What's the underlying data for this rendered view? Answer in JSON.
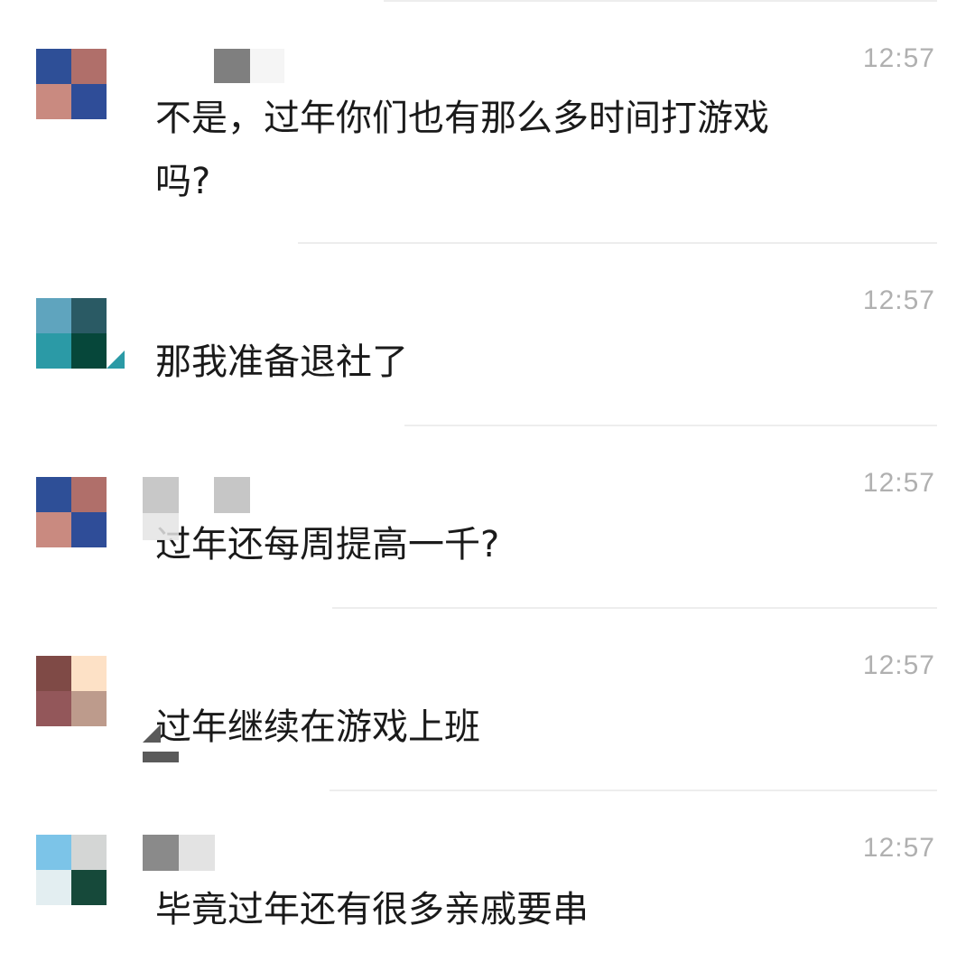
{
  "messages": [
    {
      "time": "12:57",
      "text": "不是，过年你们也有那么多时间打游戏\n吗?",
      "avatar_colors": [
        "#2e4f97",
        "#b06f6a",
        "#c98a80",
        "#2f4d98"
      ],
      "name_blur_colors": [
        "#ffffff",
        "#7f7f7f",
        "#f5f5f5"
      ]
    },
    {
      "time": "12:57",
      "text": "那我准备退社了",
      "avatar_colors": [
        "#5fa4be",
        "#2a5a64",
        "#2b9aa6",
        "#06473a"
      ],
      "name_blur_colors": []
    },
    {
      "time": "12:57",
      "text": "过年还每周提高一千?",
      "avatar_colors": [
        "#2e4f97",
        "#b06f6a",
        "#c98a80",
        "#2f4d98"
      ],
      "name_blur_colors": [
        "#c8c8c8",
        "#c6c6c6",
        "#e4e4e4"
      ]
    },
    {
      "time": "12:57",
      "text": "过年继续在游戏上班",
      "avatar_colors": [
        "#7f4a46",
        "#fde1c6",
        "#93575a",
        "#bd9b8c"
      ],
      "name_blur_colors": []
    },
    {
      "time": "12:57",
      "text": "毕竟过年还有很多亲戚要串",
      "avatar_colors": [
        "#7cc4e8",
        "#d4d6d5",
        "#e3eef1",
        "#16493a"
      ],
      "name_blur_colors": [
        "#8a8a8a",
        "#e3e3e3"
      ]
    }
  ]
}
